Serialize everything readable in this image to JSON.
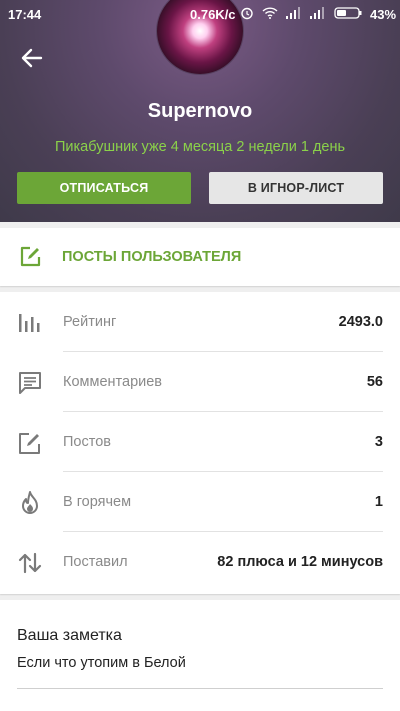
{
  "status_bar": {
    "time": "17:44",
    "speed": "0.76K/c",
    "battery": "43%"
  },
  "profile": {
    "username": "Supernovo",
    "since": "Пикабушник уже 4 месяца 2 недели 1 день",
    "unsubscribe_label": "ОТПИСАТЬСЯ",
    "ignore_label": "В ИГНОР-ЛИСТ"
  },
  "posts_link": {
    "label": "ПОСТЫ ПОЛЬЗОВАТЕЛЯ"
  },
  "stats": [
    {
      "icon": "rating-bars-icon",
      "label": "Рейтинг",
      "value": "2493.0"
    },
    {
      "icon": "comment-icon",
      "label": "Комментариев",
      "value": "56"
    },
    {
      "icon": "edit-icon",
      "label": "Постов",
      "value": "3"
    },
    {
      "icon": "fire-icon",
      "label": "В горячем",
      "value": "1"
    },
    {
      "icon": "swap-vertical-icon",
      "label": "Поставил",
      "value": "82 плюса и 12 минусов"
    }
  ],
  "note": {
    "title": "Ваша заметка",
    "text": "Если что утопим в Белой"
  },
  "colors": {
    "accent": "#6ca637",
    "accent_text": "#8bd14a"
  }
}
